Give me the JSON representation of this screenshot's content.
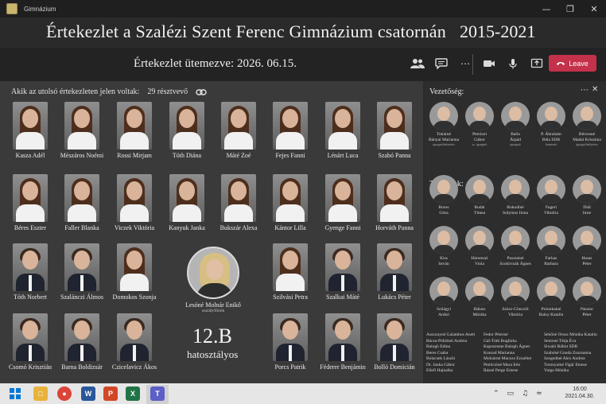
{
  "window": {
    "app_title": "Gimnázium",
    "controls": [
      "minimize-icon",
      "restore-icon",
      "close-icon"
    ]
  },
  "banner": {
    "title": "Értekezlet  a  Szalézi Szent Ferenc Gimnázium  csatornán",
    "years": "2015-2021"
  },
  "meeting": {
    "schedule_label": "Értekezlet ütemezve:",
    "schedule_date": "2026. 06.15.",
    "leave_label": "Leave",
    "icons": [
      "participants-icon",
      "chat-icon",
      "more-icon"
    ],
    "media_icons": [
      "camera-icon",
      "microphone-icon",
      "share-screen-icon"
    ]
  },
  "participants": {
    "header": "Akik az utolsó értekezleten jelen voltak:",
    "count": "29 résztvevő",
    "students": [
      "Kasza Adél",
      "Mészáros Noémi",
      "Rossi Mirjam",
      "Tóth Diána",
      "Máté Zoé",
      "Fejes Fanni",
      "Lénárt Luca",
      "Szabó Panna",
      "Béres Eszter",
      "Faller Blanka",
      "Viczek Viktória",
      "Kanyuk Janka",
      "Bukszár Alexa",
      "Kántor Lilla",
      "Gyenge Fanni",
      "Horváth Panna",
      "Tóth Norbert",
      "Szalánczi Álmos",
      "Domokos Szonja",
      "Szilvási Petra",
      "Szalkai Máté",
      "Lukács Péter",
      "Csomó Krisztián",
      "Barna Boldizsár",
      "Czicelavicz Ákos",
      "Porcs Patrik",
      "Féderer Benjámin",
      "Bolló Domicián"
    ],
    "teacher_name": "Lesóné Molnár Enikő",
    "teacher_role": "osztályfőnök",
    "class_name": "12.B",
    "class_subtitle": "hatosztályos"
  },
  "right_panel": {
    "leaders_title": "Vezetőség:",
    "teachers_title": "Tanáraink:",
    "leaders": [
      {
        "n1": "Tokárné",
        "n2": "Bányai Marianna",
        "n3": "igazgatóhelyettes"
      },
      {
        "n1": "Petrócei",
        "n2": "Gábor",
        "n3": "sz. igazgató"
      },
      {
        "n1": "Balla",
        "n2": "Árpád",
        "n3": "igazgató"
      },
      {
        "n1": "P. Ábrahám",
        "n2": "Béla SDB",
        "n3": "fenntartó"
      },
      {
        "n1": "Bércesné",
        "n2": "Madai Krisztina",
        "n3": "igazgatóhelyettes"
      }
    ],
    "teachers": [
      {
        "n1": "Boros",
        "n2": "Géza"
      },
      {
        "n1": "Budai",
        "n2": "Tímea"
      },
      {
        "n1": "Bokodiné",
        "n2": "Solymos Ilona"
      },
      {
        "n1": "Fageri",
        "n2": "Viktória"
      },
      {
        "n1": "Diál",
        "n2": "Imre"
      },
      {
        "n1": "Kiss",
        "n2": "István"
      },
      {
        "n1": "Háromszi",
        "n2": "Viola"
      },
      {
        "n1": "Pusztainé",
        "n2": "Szokircsák Ágnes"
      },
      {
        "n1": "Farkas",
        "n2": "Barbara"
      },
      {
        "n1": "Hasas",
        "n2": "Péter"
      },
      {
        "n1": "Szilágyi",
        "n2": "Anikó"
      },
      {
        "n1": "Hálasz",
        "n2": "Mónika"
      },
      {
        "n1": "Szücs-Gönczöl",
        "n2": "Viktória"
      },
      {
        "n1": "Polonkainé",
        "n2": "Baloy Katalin"
      },
      {
        "n1": "Pásztor",
        "n2": "Péter"
      }
    ],
    "staff_col1": [
      "Asszonyné Galambos Anett",
      "Bácsa-Pólidrati Andrea",
      "Balogh Edina",
      "Beres Csaba",
      "Bolacsek László",
      "Dr. Janka Gábor",
      "Ellefi Hajnalka"
    ],
    "staff_col2": [
      "Fedor Péterné",
      "Gál-Tóth Boglárka",
      "Kaposztane Balogh Ágnes",
      "Konrad Marianna",
      "Molnárné Macozs Erzsébet",
      "Petrécziné Mara Irén",
      "Rásné Perge Emese"
    ],
    "staff_col3": [
      "Sebőné Orosz Mónika Katalin",
      "Semrsei Tétja Éva",
      "Siwaló Bálint SDB",
      "Szabóné Gonda Zsuzsanna",
      "Szegediné Alex Andrea",
      "Toronyainé Figár Emese",
      "Varga Mónika"
    ]
  },
  "taskbar": {
    "apps": [
      "windows-icon",
      "file-explorer-icon",
      "chrome-icon",
      "word-icon",
      "powerpoint-icon",
      "excel-icon",
      "teams-icon"
    ],
    "time": "16:00",
    "date": "2021.04.30."
  }
}
